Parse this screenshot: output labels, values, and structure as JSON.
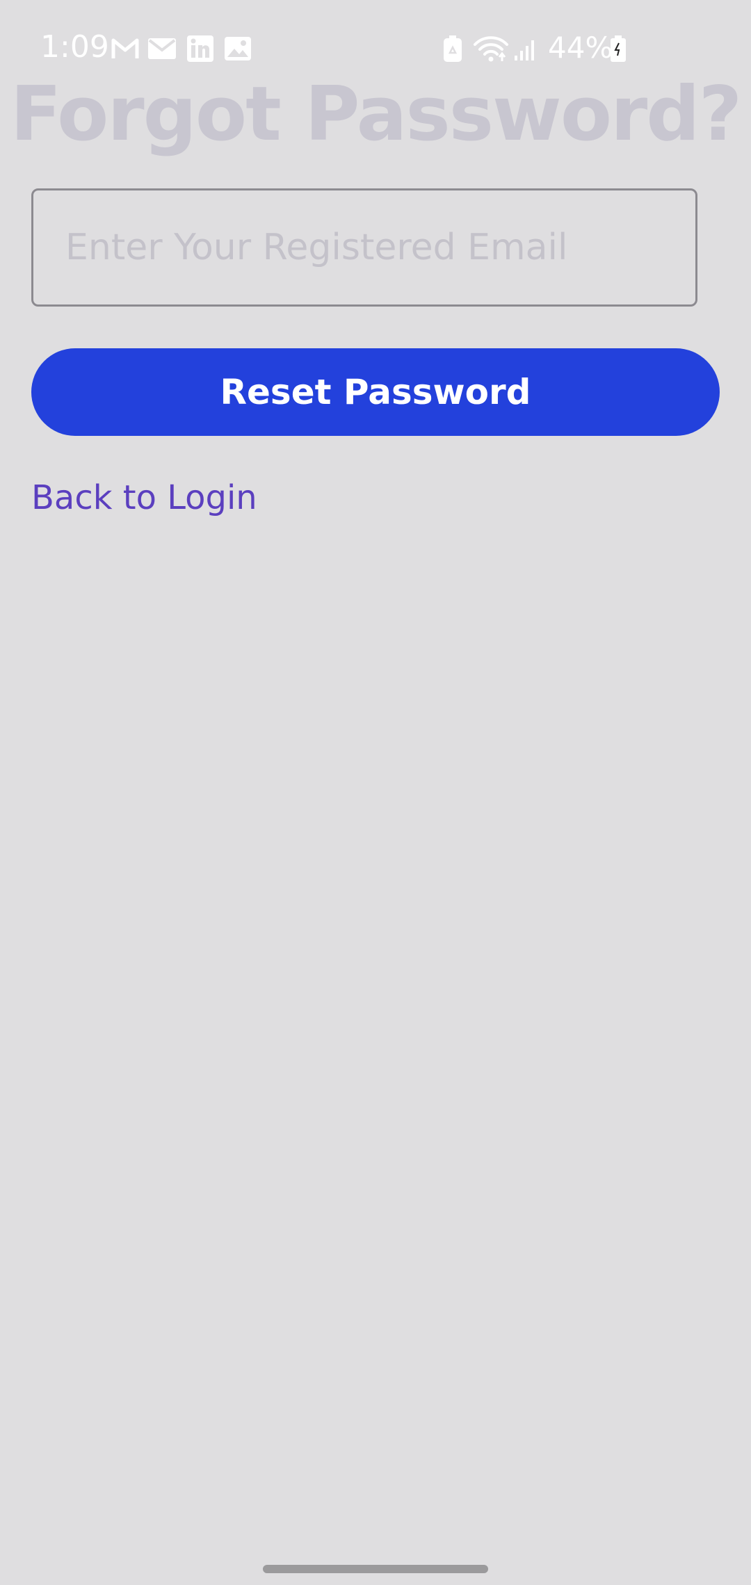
{
  "status_bar": {
    "time": "1:09",
    "battery_percent": "44%",
    "notification_icons": [
      "gmail-icon",
      "mail-icon",
      "linkedin-icon",
      "gallery-icon"
    ],
    "system_icons": [
      "battery-saver-icon",
      "wifi-icon",
      "signal-icon",
      "battery-icon"
    ]
  },
  "page": {
    "title": "Forgot Password?"
  },
  "form": {
    "email_placeholder": "Enter Your Registered Email",
    "email_value": "",
    "reset_button_label": "Reset Password",
    "back_link_label": "Back to Login"
  },
  "colors": {
    "background": "#dfdee0",
    "title": "#c8c6d0",
    "primary_button": "#2341dc",
    "link": "#5b3fbf"
  }
}
